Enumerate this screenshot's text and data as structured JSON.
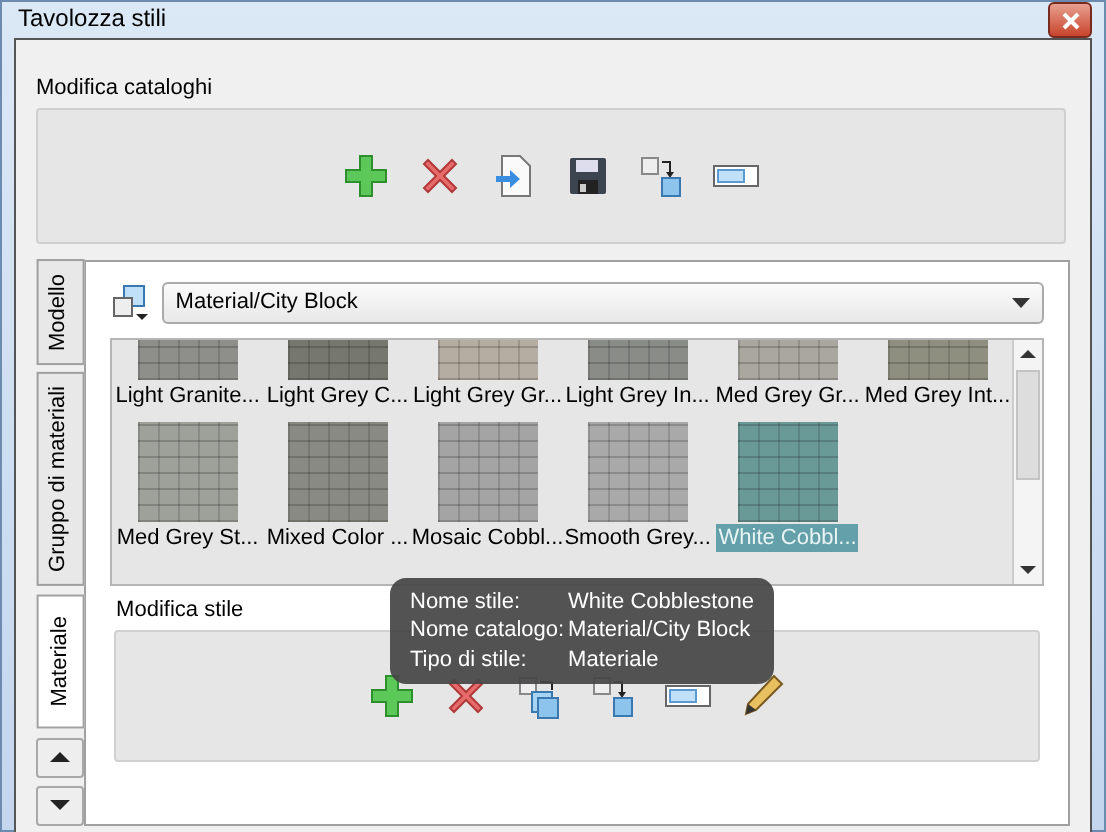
{
  "window": {
    "title": "Tavolozza stili"
  },
  "catalog_editor": {
    "label": "Modifica cataloghi"
  },
  "side_tabs": [
    {
      "label": "Modello",
      "selected": false
    },
    {
      "label": "Gruppo di materiali",
      "selected": false
    },
    {
      "label": "Materiale",
      "selected": true
    }
  ],
  "catalog_select": {
    "value": "Material/City Block"
  },
  "styles": [
    {
      "name": "Light Granite...",
      "color": "#8e8e8a",
      "selected": false
    },
    {
      "name": "Light Grey C...",
      "color": "#76776f",
      "selected": false
    },
    {
      "name": "Light Grey Gr...",
      "color": "#b5ada2",
      "selected": false
    },
    {
      "name": "Light Grey In...",
      "color": "#8a8c88",
      "selected": false
    },
    {
      "name": "Med Grey Gr...",
      "color": "#aaa7a0",
      "selected": false
    },
    {
      "name": "Med Grey Int...",
      "color": "#8f8f80",
      "selected": false
    },
    {
      "name": "Med Grey St...",
      "color": "#9ea09a",
      "selected": false
    },
    {
      "name": "Mixed Color ...",
      "color": "#8a8a84",
      "selected": false
    },
    {
      "name": "Mosaic Cobbl...",
      "color": "#a4a4a4",
      "selected": false
    },
    {
      "name": "Smooth Grey...",
      "color": "#a9a9a9",
      "selected": false
    },
    {
      "name": "White Cobbl...",
      "color": "#6a9a98",
      "selected": true
    }
  ],
  "tooltip": {
    "rows": [
      {
        "label": "Nome stile:",
        "value": "White Cobblestone"
      },
      {
        "label": "Nome catalogo:",
        "value": "Material/City Block"
      },
      {
        "label": "Tipo di stile:",
        "value": "Materiale"
      }
    ]
  },
  "style_editor": {
    "label": "Modifica stile"
  }
}
